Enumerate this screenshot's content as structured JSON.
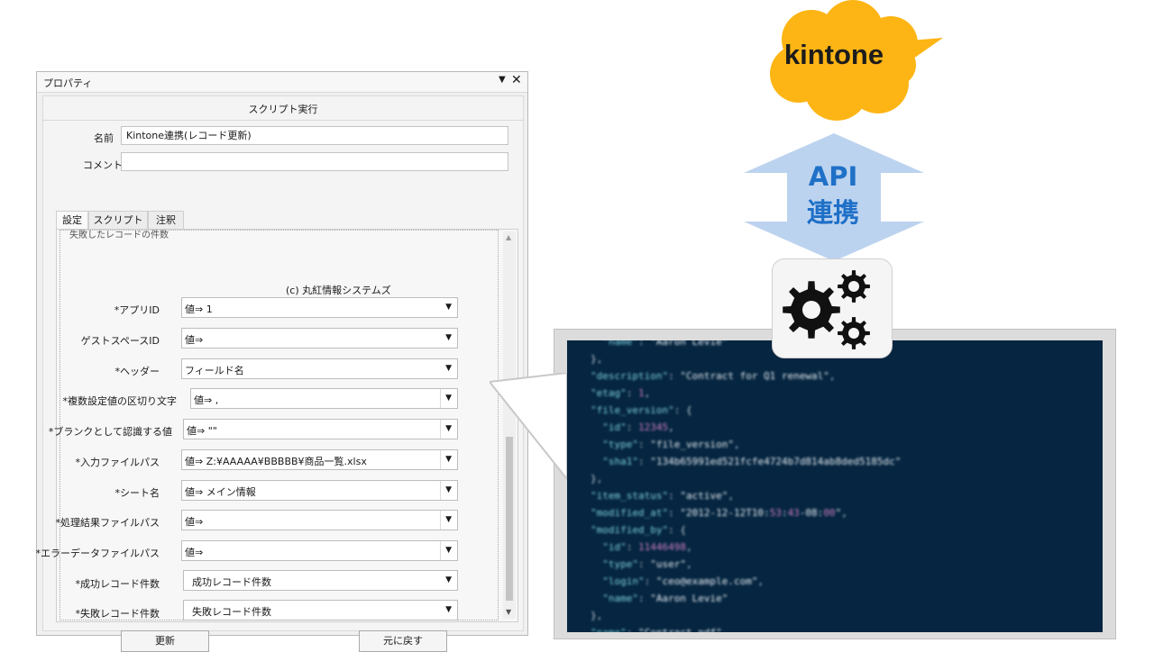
{
  "window": {
    "title": "プロパティ",
    "dropdown_icon": "▼",
    "close_icon": "✕",
    "header": "スクリプト実行",
    "name_label": "名前",
    "name_value": "Kintone連携(レコード更新)",
    "comment_label": "コメント",
    "comment_value": "",
    "tabs": [
      {
        "label": "設定"
      },
      {
        "label": "スクリプト"
      },
      {
        "label": "注釈"
      }
    ],
    "cutoff_text": "失敗したレコードの件数",
    "copyright": "(c) 丸紅情報システムズ",
    "params": [
      {
        "label": "*アプリID",
        "value": "値⇒  1"
      },
      {
        "label": "ゲストスペースID",
        "value": "値⇒"
      },
      {
        "label": "*ヘッダー",
        "value": "フィールド名"
      },
      {
        "label": "*複数設定値の区切り文字",
        "value": "値⇒  ,"
      },
      {
        "label": "*ブランクとして認識する値",
        "value": "値⇒  \"\""
      },
      {
        "label": "*入力ファイルパス",
        "value": "値⇒  Z:¥AAAAA¥BBBBB¥商品一覧.xlsx"
      },
      {
        "label": "*シート名",
        "value": "値⇒  メイン情報"
      },
      {
        "label": "*処理結果ファイルパス",
        "value": "値⇒"
      },
      {
        "label": "*エラーデータファイルパス",
        "value": "値⇒"
      },
      {
        "label": "*成功レコード件数",
        "value": "成功レコード件数"
      },
      {
        "label": "*失敗レコード件数",
        "value": "失敗レコード件数"
      }
    ],
    "update_button": "更新",
    "revert_button": "元に戻す"
  },
  "illustration": {
    "cloud_label": "kintone",
    "cloud_color": "#fdb515",
    "api_line1": "API",
    "api_line2": "連携",
    "arrow_color": "#bcd3ef",
    "api_text_color": "#1f70c7",
    "gear_icon": "gears-icon",
    "code_background": "#052540",
    "code_lines": [
      "  \"name\": \"Aaron Levie\"",
      "},",
      "\"description\": \"Contract for Q1 renewal\",",
      "\"etag\": 1,",
      "\"file_version\": {",
      "  \"id\": 12345,",
      "  \"type\": \"file_version\",",
      "  \"sha1\": \"134b65991ed521fcfe4724b7d814ab8ded5185dc\"",
      "},",
      "\"item_status\": \"active\",",
      "\"modified_at\": \"2012-12-12T10:53:43-08:00\",",
      "\"modified_by\": {",
      "  \"id\": 11446498,",
      "  \"type\": \"user\",",
      "  \"login\": \"ceo@example.com\",",
      "  \"name\": \"Aaron Levie\"",
      "},",
      "\"name\": \"Contract.pdf\","
    ]
  }
}
